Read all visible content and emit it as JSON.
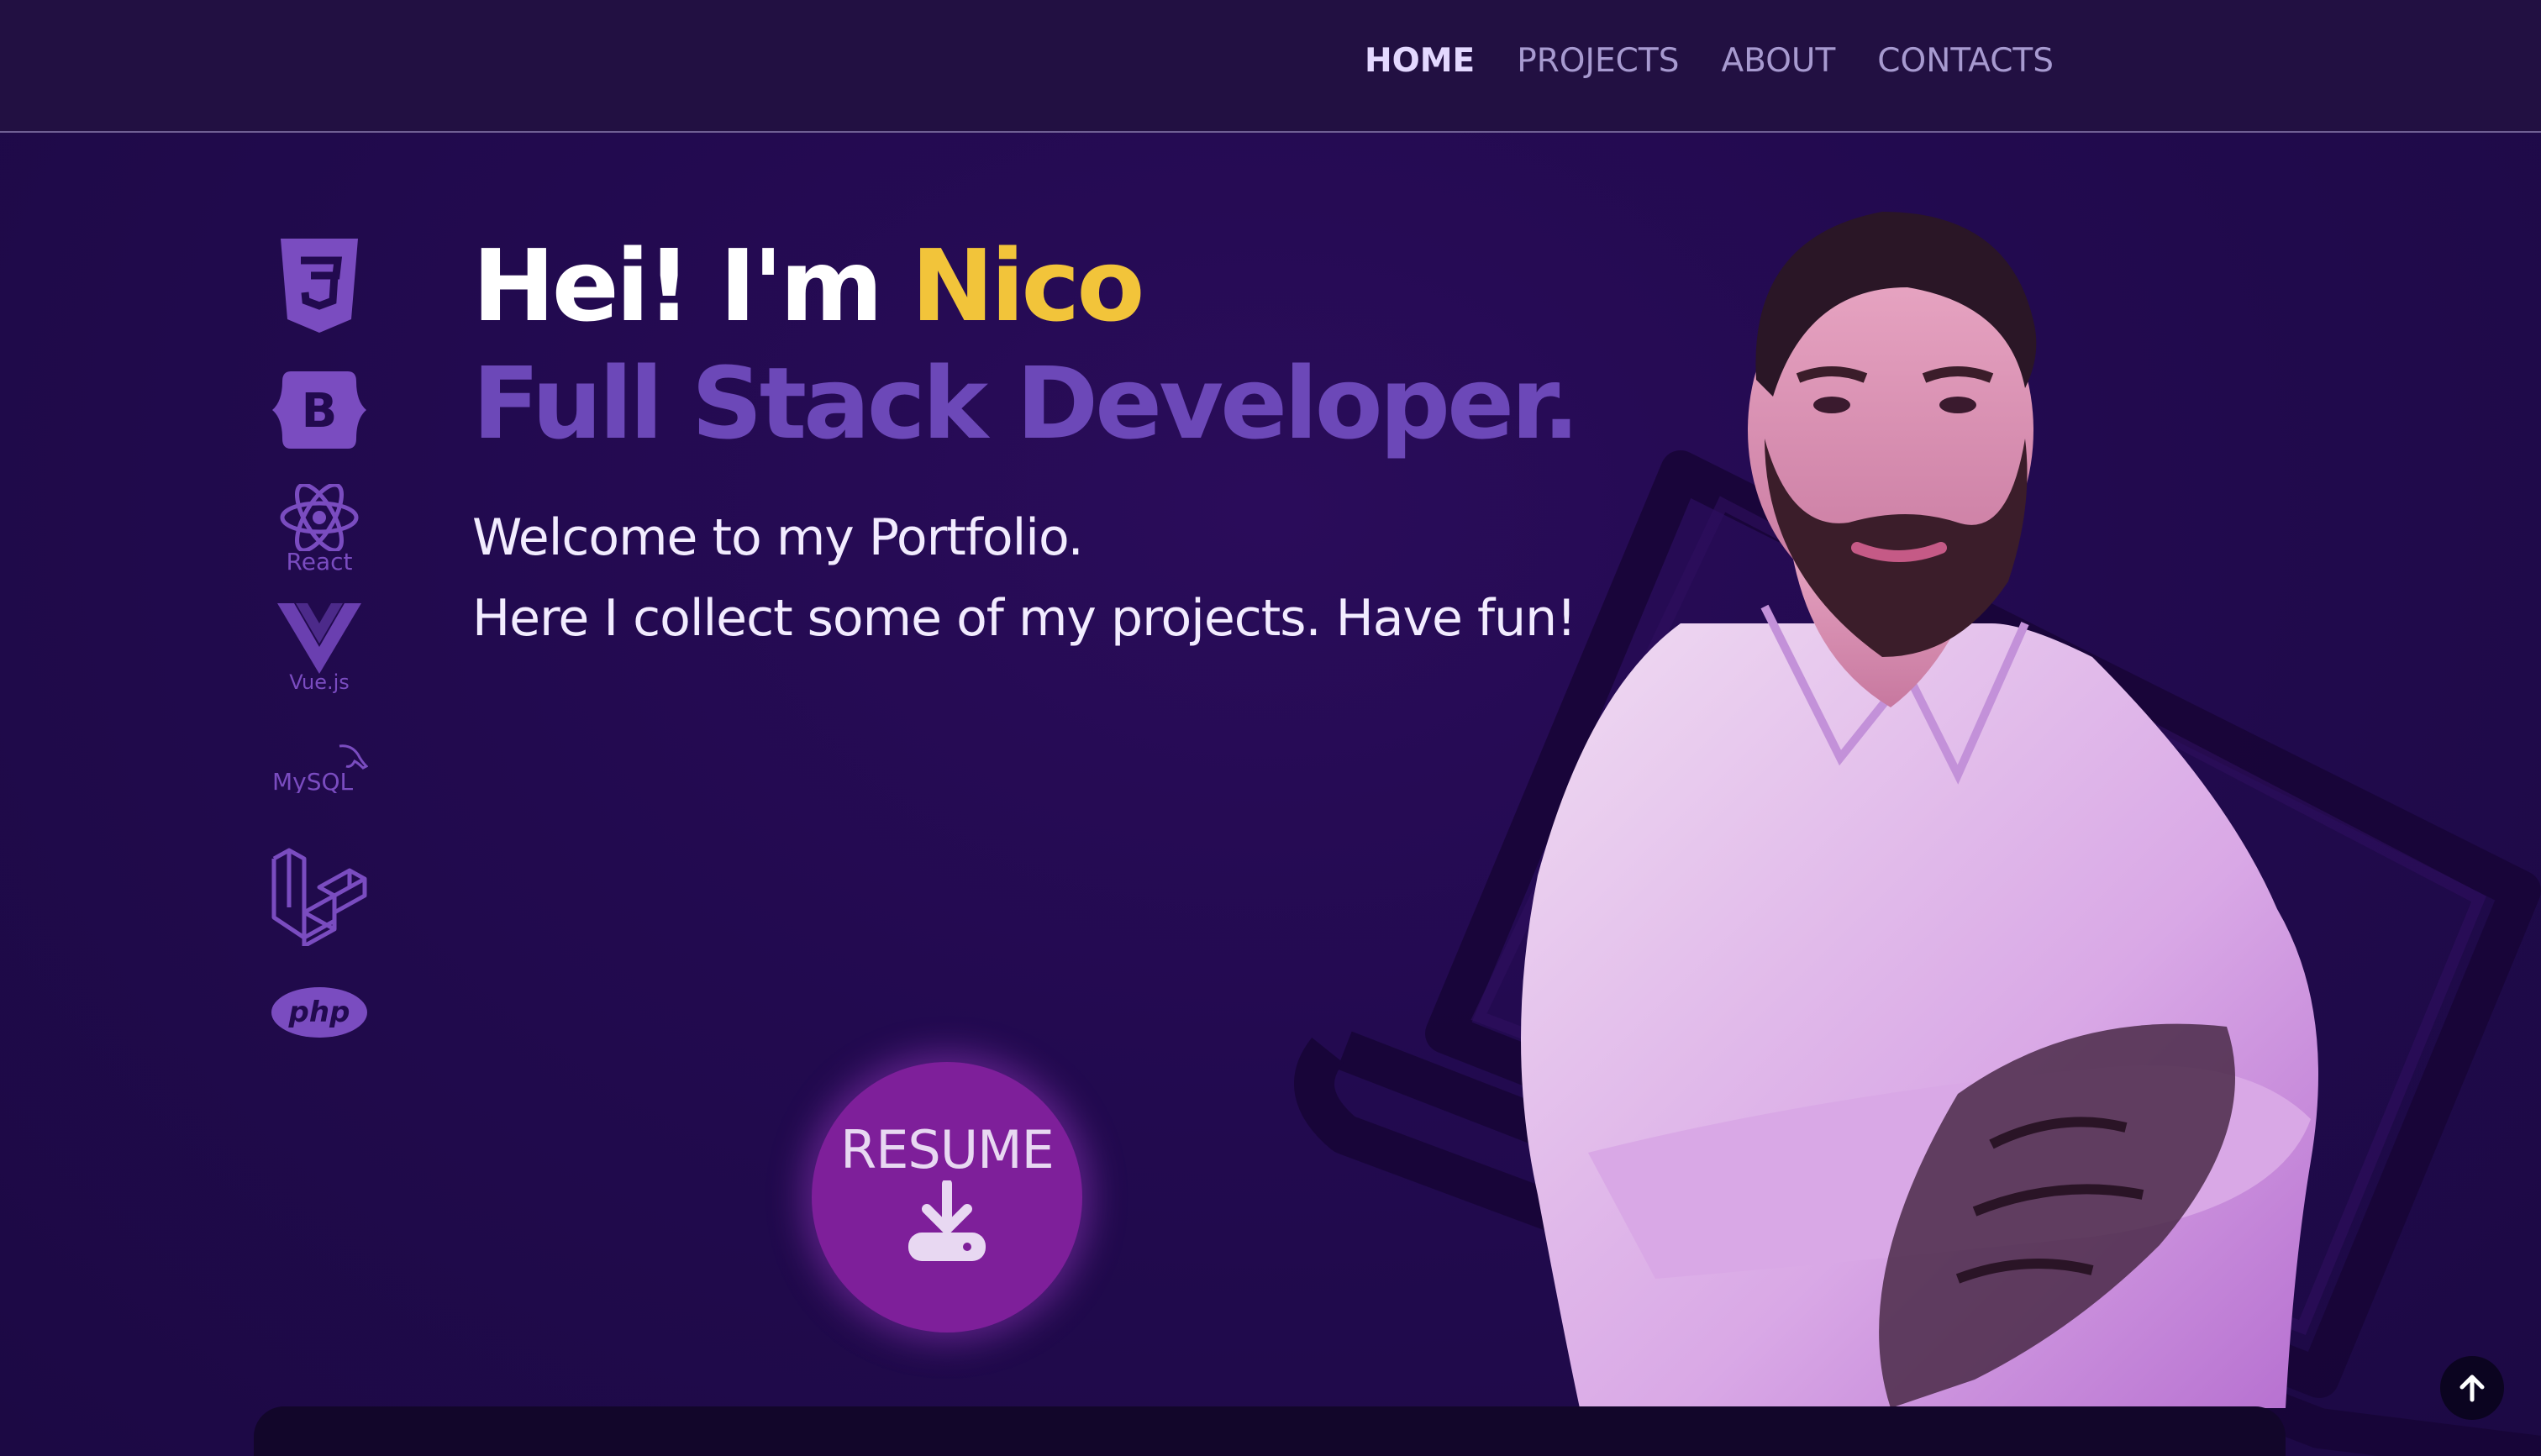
{
  "nav": {
    "links": [
      {
        "label": "HOME",
        "active": true
      },
      {
        "label": "PROJECTS",
        "active": false
      },
      {
        "label": "ABOUT",
        "active": false
      },
      {
        "label": "CONTACTS",
        "active": false
      }
    ]
  },
  "hero": {
    "greeting": "Hei! I'm ",
    "name": "Nico",
    "role": "Full Stack Developer.",
    "line1": "Welcome to my Portfolio.",
    "line2": "Here I collect some of my projects. Have fun!"
  },
  "tech_icons": [
    {
      "name": "css3-icon",
      "caption": ""
    },
    {
      "name": "bootstrap-icon",
      "caption": ""
    },
    {
      "name": "react-icon",
      "caption": "React"
    },
    {
      "name": "vuejs-icon",
      "caption": "Vue.js"
    },
    {
      "name": "mysql-icon",
      "caption": "MySQL"
    },
    {
      "name": "laravel-icon",
      "caption": ""
    },
    {
      "name": "php-icon",
      "caption": "php"
    }
  ],
  "resume": {
    "label": "RESUME",
    "icon": "download-icon"
  },
  "scroll_top": {
    "icon": "arrow-up-icon"
  },
  "colors": {
    "background": "#220a4f",
    "accent_name": "#f2c43a",
    "role": "#6c48b8",
    "resume": "#7e1f9a",
    "icons": "#7a4cc0"
  }
}
